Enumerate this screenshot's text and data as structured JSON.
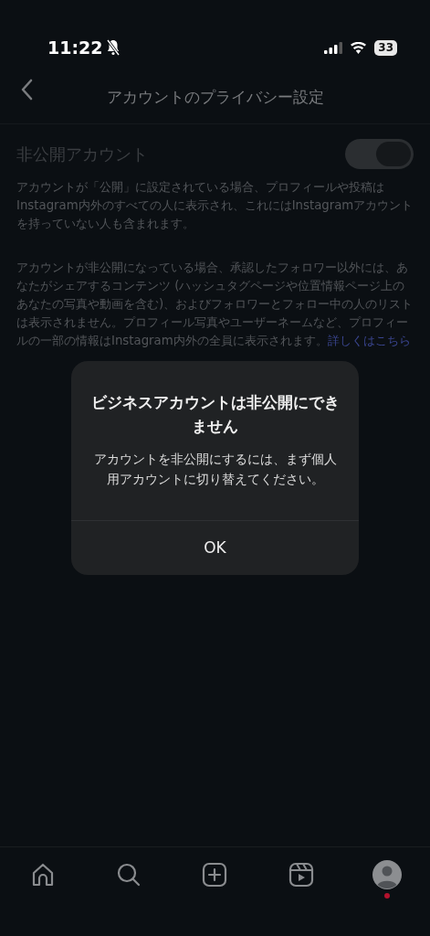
{
  "status_bar": {
    "time": "11:22",
    "muted": true,
    "battery": "33"
  },
  "header": {
    "title": "アカウントのプライバシー設定"
  },
  "private_account": {
    "label": "非公開アカウント",
    "on": true
  },
  "descriptions": [
    {
      "text": "アカウントが「公開」に設定されている場合、プロフィールや投稿はInstagram内外のすべての人に表示され、これにはInstagramアカウントを持っていない人も含まれます。"
    },
    {
      "text": "アカウントが非公開になっている場合、承認したフォロワー以外には、あなたがシェアするコンテンツ (ハッシュタグページや位置情報ページ上のあなたの写真や動画を含む)、およびフォロワーとフォロー中の人のリストは表示されません。プロフィール写真やユーザーネームなど、プロフィールの一部の情報はInstagram内外の全員に表示されます。",
      "link": "詳しくはこちら"
    }
  ],
  "dialog": {
    "title": "ビジネスアカウントは非公開にできません",
    "message": "アカウントを非公開にするには、まず個人用アカウントに切り替えてください。",
    "button": "OK"
  },
  "tab_bar": [
    {
      "kind": "home",
      "notification": false
    },
    {
      "kind": "search",
      "notification": false
    },
    {
      "kind": "create",
      "notification": false
    },
    {
      "kind": "reels",
      "notification": false
    },
    {
      "kind": "profile",
      "notification": true
    }
  ]
}
